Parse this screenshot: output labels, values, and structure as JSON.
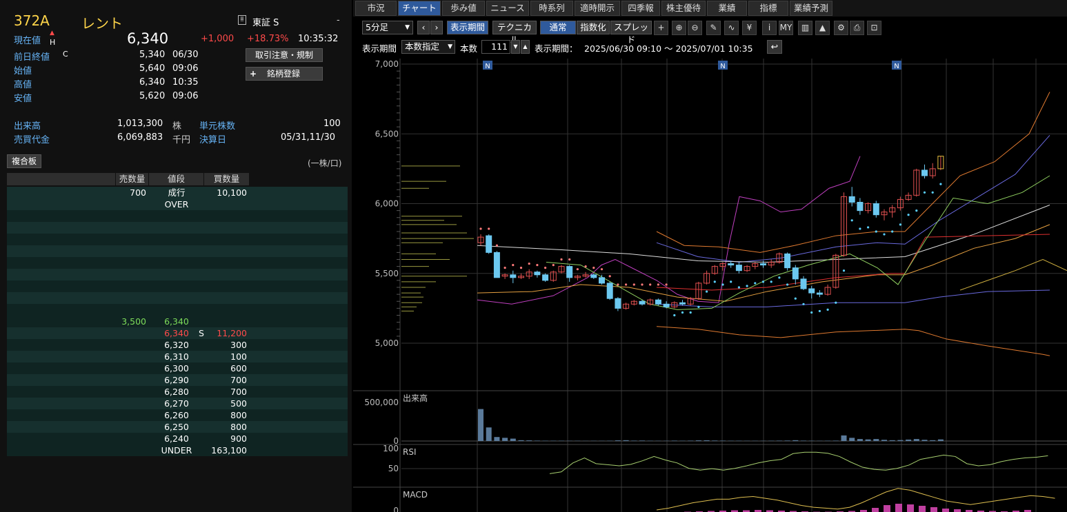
{
  "quote": {
    "code": "372A",
    "name": "レント",
    "market": "東証 S",
    "market_mark": "-",
    "current_label": "現在値",
    "up_mark": "▲",
    "h_mark": "H",
    "price": "6,340",
    "change": "+1,000",
    "change_pct": "+18.73%",
    "time": "10:35:32",
    "rows": [
      {
        "label": "前日終値",
        "flag": "C",
        "value": "5,340",
        "when": "06/30"
      },
      {
        "label": "始値",
        "flag": "",
        "value": "5,640",
        "when": "09:06"
      },
      {
        "label": "高値",
        "flag": "",
        "value": "6,340",
        "when": "10:35"
      },
      {
        "label": "安値",
        "flag": "",
        "value": "5,620",
        "when": "09:06"
      }
    ],
    "btn_rules": "取引注意・規制",
    "btn_register": "銘柄登録",
    "btn_register_plus": "+",
    "volume_label": "出来高",
    "volume": "1,013,300",
    "volume_unit": "株",
    "turnover_label": "売買代金",
    "turnover": "6,069,883",
    "turnover_unit": "千円",
    "unit_label": "単元株数",
    "unit": "100",
    "settle_label": "決算日",
    "settle": "05/31,11/30"
  },
  "book": {
    "tab": "複合板",
    "unit_note": "(一株/口)",
    "headers": [
      "売数量",
      "値段",
      "買数量"
    ],
    "top": [
      {
        "sell": "700",
        "price": "成行",
        "buy": "10,100"
      },
      {
        "sell": "",
        "price": "OVER",
        "buy": ""
      }
    ],
    "asks": [
      {
        "sell": "3,500",
        "price": "6,340",
        "buy": ""
      }
    ],
    "current": {
      "sell": "",
      "price": "6,340",
      "mark": "S",
      "buy": "11,200"
    },
    "bids": [
      {
        "price": "6,320",
        "buy": "300"
      },
      {
        "price": "6,310",
        "buy": "100"
      },
      {
        "price": "6,300",
        "buy": "600"
      },
      {
        "price": "6,290",
        "buy": "700"
      },
      {
        "price": "6,280",
        "buy": "700"
      },
      {
        "price": "6,270",
        "buy": "500"
      },
      {
        "price": "6,260",
        "buy": "800"
      },
      {
        "price": "6,250",
        "buy": "800"
      },
      {
        "price": "6,240",
        "buy": "900"
      }
    ],
    "under": {
      "price": "UNDER",
      "buy": "163,100"
    }
  },
  "tabs": [
    "市況",
    "チャート",
    "歩み値",
    "ニュース",
    "時系列",
    "適時開示",
    "四季報",
    "株主優待",
    "業績",
    "指標",
    "業績予測"
  ],
  "toolbar": {
    "interval": "5分足",
    "period_btn": "表示期間",
    "tech_btn": "テクニカル",
    "normal_btn": "通常",
    "index_btn": "指数化",
    "spread_btn": "スプレッド",
    "period_label": "表示期間",
    "period_mode": "本数指定",
    "count_label": "本数",
    "count": "111",
    "range_label": "表示期間：",
    "range": "2025/06/30 09:10 〜 2025/07/01 10:35",
    "icons": [
      "plus-icon",
      "zoom-in-icon",
      "zoom-out-icon",
      "pen-icon",
      "wave-icon",
      "yen-icon",
      "info-icon",
      "my-icon",
      "candle-icon",
      "area-icon",
      "wrench-icon",
      "print-icon",
      "window-icon"
    ]
  },
  "chart_data": {
    "type": "candlestick",
    "price_axis": {
      "ticks": [
        "7,000",
        "6,500",
        "6,000",
        "5,500",
        "5,000"
      ],
      "ylim": [
        4970,
        7000
      ]
    },
    "news_marker": "N",
    "volume_axis": {
      "label": "出来高",
      "ticks": [
        "500,000",
        "0"
      ]
    },
    "rsi_axis": {
      "label": "RSI",
      "ticks": [
        "100",
        "50"
      ]
    },
    "macd_axis": {
      "label": "MACD",
      "ticks": [
        "0"
      ]
    },
    "candles": [
      [
        5720,
        5780,
        5700,
        5760
      ],
      [
        5770,
        5780,
        5640,
        5650
      ],
      [
        5650,
        5660,
        5490,
        5470
      ],
      [
        5480,
        5500,
        5460,
        5490
      ],
      [
        5490,
        5520,
        5430,
        5470
      ],
      [
        5470,
        5500,
        5460,
        5480
      ],
      [
        5480,
        5530,
        5460,
        5510
      ],
      [
        5510,
        5520,
        5470,
        5490
      ],
      [
        5490,
        5500,
        5440,
        5450
      ],
      [
        5450,
        5520,
        5440,
        5510
      ],
      [
        5510,
        5560,
        5500,
        5550
      ],
      [
        5550,
        5560,
        5440,
        5470
      ],
      [
        5470,
        5490,
        5450,
        5480
      ],
      [
        5480,
        5510,
        5470,
        5490
      ],
      [
        5490,
        5500,
        5460,
        5470
      ],
      [
        5470,
        5490,
        5420,
        5430
      ],
      [
        5430,
        5440,
        5310,
        5320
      ],
      [
        5320,
        5330,
        5230,
        5250
      ],
      [
        5250,
        5290,
        5240,
        5280
      ],
      [
        5280,
        5310,
        5270,
        5300
      ],
      [
        5300,
        5310,
        5270,
        5280
      ],
      [
        5280,
        5320,
        5270,
        5310
      ],
      [
        5310,
        5320,
        5270,
        5280
      ],
      [
        5280,
        5300,
        5250,
        5260
      ],
      [
        5260,
        5300,
        5250,
        5290
      ],
      [
        5290,
        5310,
        5270,
        5280
      ],
      [
        5280,
        5330,
        5270,
        5320
      ],
      [
        5320,
        5440,
        5310,
        5430
      ],
      [
        5430,
        5520,
        5420,
        5500
      ],
      [
        5500,
        5560,
        5490,
        5550
      ],
      [
        5550,
        5580,
        5520,
        5570
      ],
      [
        5570,
        5590,
        5540,
        5560
      ],
      [
        5560,
        5580,
        5500,
        5520
      ],
      [
        5520,
        5560,
        5510,
        5550
      ],
      [
        5550,
        5580,
        5530,
        5570
      ],
      [
        5570,
        5590,
        5540,
        5560
      ],
      [
        5560,
        5600,
        5540,
        5580
      ],
      [
        5580,
        5650,
        5570,
        5640
      ],
      [
        5640,
        5650,
        5520,
        5540
      ],
      [
        5540,
        5560,
        5420,
        5460
      ],
      [
        5460,
        5480,
        5380,
        5390
      ],
      [
        5390,
        5410,
        5320,
        5360
      ],
      [
        5360,
        5380,
        5330,
        5350
      ],
      [
        5350,
        5420,
        5340,
        5400
      ],
      [
        5400,
        5640,
        5390,
        5630
      ],
      [
        5630,
        6080,
        5620,
        6050
      ],
      [
        6050,
        6120,
        5980,
        6010
      ],
      [
        6010,
        6040,
        5920,
        5950
      ],
      [
        5950,
        6010,
        5930,
        6000
      ],
      [
        6000,
        6020,
        5900,
        5920
      ],
      [
        5920,
        5960,
        5880,
        5940
      ],
      [
        5940,
        5990,
        5900,
        5970
      ],
      [
        5970,
        6050,
        5950,
        6030
      ],
      [
        6030,
        6080,
        6020,
        6060
      ],
      [
        6060,
        6250,
        6050,
        6240
      ],
      [
        6240,
        6280,
        6180,
        6200
      ],
      [
        6200,
        6290,
        6180,
        6250
      ],
      [
        6250,
        6340,
        6240,
        6340
      ]
    ],
    "volume": [
      400000,
      170000,
      50000,
      40000,
      30000,
      10000,
      8000,
      5000,
      4000,
      4000,
      4000,
      3000,
      3000,
      2000,
      3000,
      3000,
      4000,
      8000,
      10000,
      5000,
      6000,
      4000,
      3000,
      3000,
      5000,
      4000,
      5000,
      8000,
      9000,
      6000,
      5000,
      4000,
      4000,
      3000,
      3000,
      3000,
      4000,
      5000,
      6000,
      10000,
      5000,
      4000,
      3000,
      4000,
      5000,
      70000,
      40000,
      25000,
      20000,
      25000,
      15000,
      10000,
      12000,
      18000,
      25000,
      15000,
      10000,
      20000
    ],
    "rsi": [
      30,
      35,
      60,
      74,
      58,
      55,
      52,
      56,
      66,
      78,
      68,
      60,
      45,
      40,
      44,
      40,
      45,
      52,
      60,
      66,
      70,
      86,
      90,
      90,
      87,
      78,
      62,
      48,
      42,
      40,
      45,
      54,
      70,
      76,
      82,
      78,
      58,
      52,
      55,
      64,
      70,
      74,
      76,
      80
    ],
    "macd": [
      0,
      2,
      5,
      8,
      10,
      12,
      12,
      14,
      15,
      13,
      11,
      8,
      5,
      3,
      2,
      1,
      3,
      8,
      14,
      20,
      24,
      22,
      18,
      14,
      10,
      8,
      6,
      8,
      10,
      12,
      14,
      16,
      15,
      13
    ],
    "macd_hist": [
      1,
      2,
      3,
      4,
      5,
      5,
      6,
      5,
      4,
      3,
      2,
      1,
      1,
      2,
      3,
      6,
      12,
      20,
      24,
      22,
      18,
      14,
      10,
      8,
      6,
      4,
      3,
      2,
      4,
      6
    ]
  }
}
